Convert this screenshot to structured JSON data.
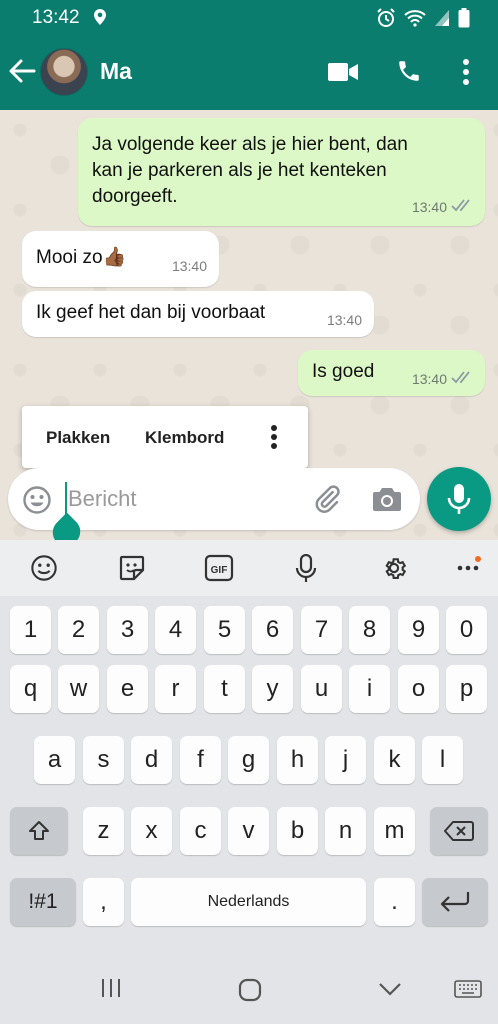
{
  "status_bar": {
    "time": "13:42"
  },
  "app_bar": {
    "contact_name": "Ma"
  },
  "messages": [
    {
      "text_lines": [
        "Ja volgende keer als je hier bent, dan",
        "kan je parkeren als je het kenteken",
        "doorgeeft."
      ],
      "time": "13:40",
      "direction": "outgoing"
    },
    {
      "text": "Mooi zo👍🏾",
      "time": "13:40",
      "direction": "incoming"
    },
    {
      "text": "Ik geef het dan bij voorbaat",
      "time": "13:40",
      "direction": "incoming"
    },
    {
      "text": "Is goed",
      "time": "13:40",
      "direction": "outgoing"
    }
  ],
  "context_menu": {
    "paste": "Plakken",
    "clipboard": "Klembord"
  },
  "composer": {
    "placeholder": "Bericht",
    "value": ""
  },
  "keyboard": {
    "number_row": [
      "1",
      "2",
      "3",
      "4",
      "5",
      "6",
      "7",
      "8",
      "9",
      "0"
    ],
    "row1": [
      "q",
      "w",
      "e",
      "r",
      "t",
      "y",
      "u",
      "i",
      "o",
      "p"
    ],
    "row2": [
      "a",
      "s",
      "d",
      "f",
      "g",
      "h",
      "j",
      "k",
      "l"
    ],
    "row3": [
      "z",
      "x",
      "c",
      "v",
      "b",
      "n",
      "m"
    ],
    "symbols_label": "!#1",
    "comma": ",",
    "space_label": "Nederlands",
    "period": ".",
    "gif_label": "GIF"
  },
  "colors": {
    "primary": "#0a7d6e",
    "accent": "#0a9a83",
    "outgoing_bubble": "#dcf8c6",
    "incoming_bubble": "#ffffff",
    "notification_dot": "#f26a22"
  }
}
